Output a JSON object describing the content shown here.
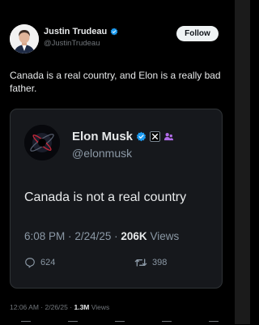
{
  "author": {
    "name": "Justin Trudeau",
    "handle": "@JustinTrudeau",
    "avatar": "avatar-photo",
    "verified_icon": "verified-badge-icon"
  },
  "follow_label": "Follow",
  "tweet_text": "Canada is a real country, and Elon is a really bad father.",
  "quoted": {
    "name": "Elon Musk",
    "handle": "@elonmusk",
    "badges": [
      "verified-badge-icon",
      "x-affiliate-icon",
      "people-icon"
    ],
    "text": "Canada is not a real country",
    "time": "6:08 PM",
    "date": "2/24/25",
    "views_count": "206K",
    "views_label": "Views",
    "separator": "·",
    "replies": "624",
    "reposts": "398"
  },
  "meta": {
    "time": "12:06 AM",
    "date": "2/26/25",
    "views_count": "1.3M",
    "views_label": "Views",
    "separator": "·"
  },
  "colors": {
    "background": "#000000",
    "verified_blue": "#1d9bf0",
    "people_purple": "#b16ce8"
  }
}
